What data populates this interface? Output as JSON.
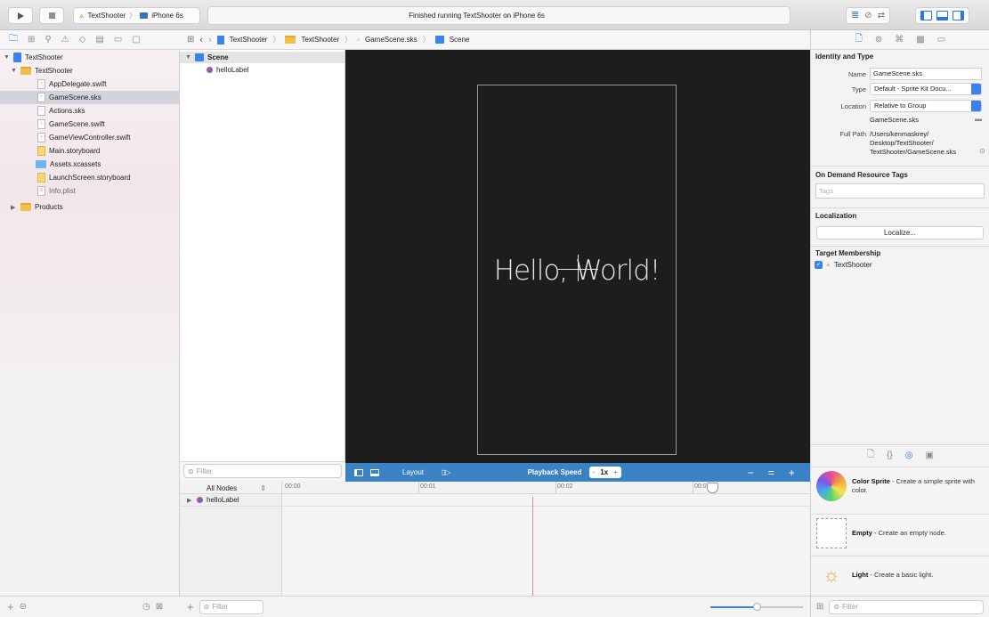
{
  "toolbar": {
    "scheme_project": "TextShooter",
    "scheme_device": "iPhone 6s",
    "activity_status": "Finished running TextShooter on iPhone 6s"
  },
  "navigator": {
    "items": [
      {
        "label": "TextShooter",
        "kind": "project"
      },
      {
        "label": "TextShooter",
        "kind": "folder"
      },
      {
        "label": "AppDelegate.swift",
        "kind": "swift"
      },
      {
        "label": "GameScene.sks",
        "kind": "sks"
      },
      {
        "label": "Actions.sks",
        "kind": "sks"
      },
      {
        "label": "GameScene.swift",
        "kind": "swift"
      },
      {
        "label": "GameViewController.swift",
        "kind": "swift"
      },
      {
        "label": "Main.storyboard",
        "kind": "storyboard"
      },
      {
        "label": "Assets.xcassets",
        "kind": "assets"
      },
      {
        "label": "LaunchScreen.storyboard",
        "kind": "storyboard"
      },
      {
        "label": "Info.plist",
        "kind": "plist"
      },
      {
        "label": "Products",
        "kind": "folder"
      }
    ]
  },
  "jumpbar": {
    "crumbs": [
      "TextShooter",
      "TextShooter",
      "GameScene.sks",
      "Scene"
    ]
  },
  "outline": {
    "root": "Scene",
    "child": "helloLabel",
    "filter_placeholder": "Filter"
  },
  "scene": {
    "label_text": "Hello, World!"
  },
  "timeline_bar": {
    "layout_label": "Layout",
    "playback_label": "Playback Speed",
    "speed_value": "1x"
  },
  "timeline": {
    "nodes_selector": "All Nodes",
    "ticks": [
      "00:00",
      "00:01",
      "00:02",
      "00:0"
    ],
    "row_label": "helloLabel",
    "filter_placeholder": "Filter"
  },
  "inspector": {
    "identity_title": "Identity and Type",
    "name_label": "Name",
    "name_value": "GameScene.sks",
    "type_label": "Type",
    "type_value": "Default - Sprite Kit Docu...",
    "location_label": "Location",
    "location_value": "Relative to Group",
    "location_file": "GameScene.sks",
    "fullpath_label": "Full Path",
    "fullpath_1": "/Users/kenmaskrey/",
    "fullpath_2": "Desktop/TextShooter/",
    "fullpath_3": "TextShooter/GameScene.sks",
    "odr_title": "On Demand Resource Tags",
    "tags_placeholder": "Tags",
    "localization_title": "Localization",
    "localize_button": "Localize...",
    "target_title": "Target Membership",
    "target_name": "TextShooter"
  },
  "library": {
    "items": [
      {
        "name": "Color Sprite",
        "desc": " - Create a simple sprite with color."
      },
      {
        "name": "Empty",
        "desc": " - Create an empty node."
      },
      {
        "name": "Light",
        "desc": " - Create a basic light."
      }
    ],
    "filter_placeholder": "Filter"
  },
  "colors": {
    "accent": "#3b82c4",
    "canvas": "#1d1d1d",
    "playhead": "#f08a8a"
  }
}
